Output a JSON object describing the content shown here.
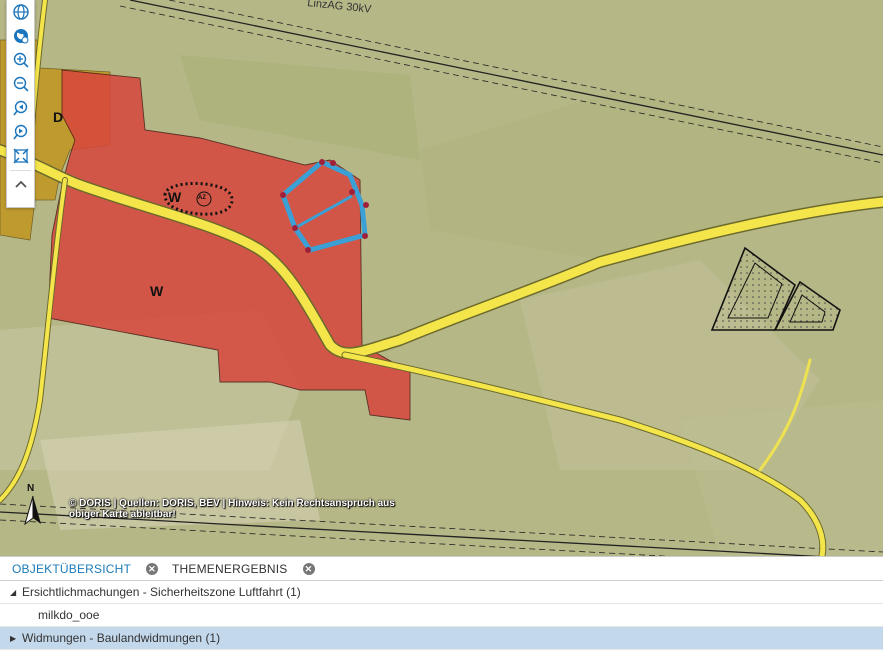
{
  "map": {
    "line_label": "LinzAG 30kV",
    "zone_labels": {
      "d": "D",
      "w_main": "W",
      "w_small": "W",
      "az": "AZ"
    },
    "copyright": "© DORIS | Quellen: DORIS, BEV | Hinweis: Kein Rechtsanspruch aus obiger Karte ableitbar!",
    "north_label": "N",
    "colors": {
      "background": "#b8b889",
      "zone_w": "#d8463c",
      "zone_d": "#c2961c",
      "road": "#f4e64a",
      "selection": "#3aa0d6",
      "vertex": "#a0203a"
    }
  },
  "toolbar": {
    "tools": [
      {
        "name": "globe-icon"
      },
      {
        "name": "globe-locate-icon"
      },
      {
        "name": "zoom-in-icon"
      },
      {
        "name": "zoom-out-icon"
      },
      {
        "name": "zoom-previous-icon"
      },
      {
        "name": "zoom-next-icon"
      },
      {
        "name": "full-extent-icon"
      },
      {
        "name": "collapse-icon"
      }
    ]
  },
  "panel": {
    "tabs": [
      {
        "label": "OBJEKTÜBERSICHT",
        "active": true
      },
      {
        "label": "THEMENERGEBNIS",
        "active": false
      }
    ],
    "rows": [
      {
        "label": "Ersichtlichmachungen - Sicherheitszone Luftfahrt (1)",
        "expanded": true
      },
      {
        "label": "milkdo_ooe"
      },
      {
        "label": "Widmungen - Baulandwidmungen (1)",
        "expanded": false,
        "selected": true
      }
    ]
  }
}
